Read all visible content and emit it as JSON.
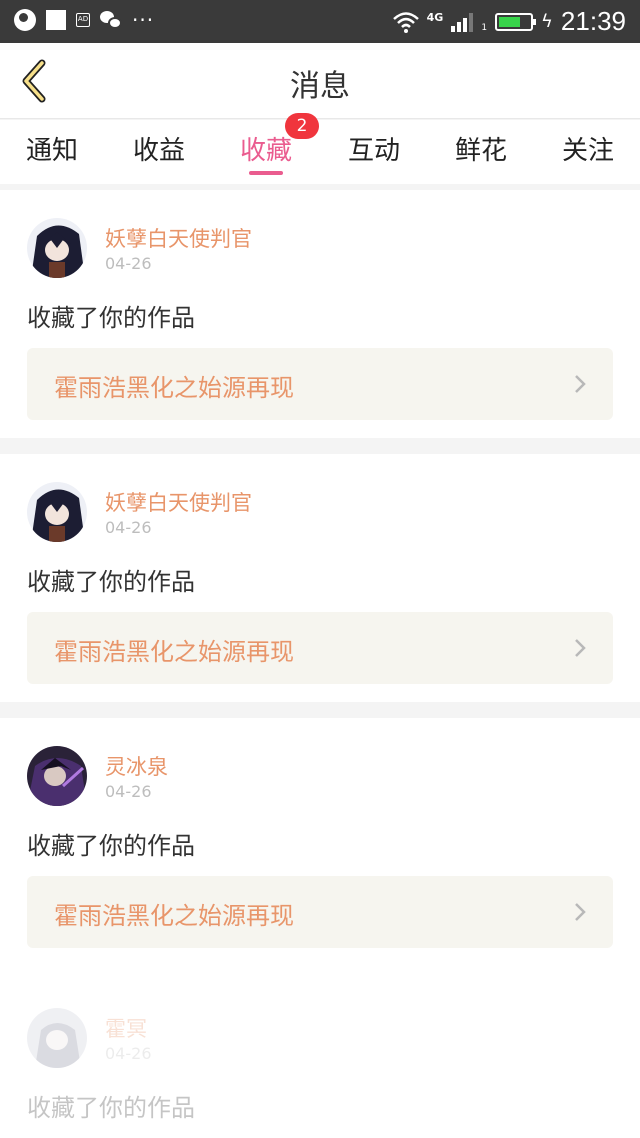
{
  "status_bar": {
    "network": "4G",
    "sim": "1",
    "time": "21:39",
    "icons": [
      "globe-icon",
      "square-icon",
      "ad-icon",
      "wechat-icon",
      "more-icon",
      "wifi-icon",
      "signal-icon",
      "battery-icon",
      "charging-icon"
    ]
  },
  "header": {
    "title": "消息",
    "back_icon": "chevron-left-icon"
  },
  "tabs": [
    {
      "label": "通知"
    },
    {
      "label": "收益"
    },
    {
      "label": "收藏",
      "active": true,
      "badge": "2"
    },
    {
      "label": "互动"
    },
    {
      "label": "鲜花"
    },
    {
      "label": "关注"
    }
  ],
  "messages": [
    {
      "user": "妖孽白天使判官",
      "date": "04-26",
      "action": "收藏了你的作品",
      "work": "霍雨浩黑化之始源再现"
    },
    {
      "user": "妖孽白天使判官",
      "date": "04-26",
      "action": "收藏了你的作品",
      "work": "霍雨浩黑化之始源再现"
    },
    {
      "user": "灵冰泉",
      "date": "04-26",
      "action": "收藏了你的作品",
      "work": "霍雨浩黑化之始源再现"
    },
    {
      "user": "霍冥",
      "date": "04-26",
      "action": "收藏了你的作品"
    }
  ],
  "colors": {
    "accent_pink": "#ea5c8f",
    "username_orange": "#e8956a",
    "badge_red": "#f0353d",
    "battery_green": "#39d44b"
  }
}
